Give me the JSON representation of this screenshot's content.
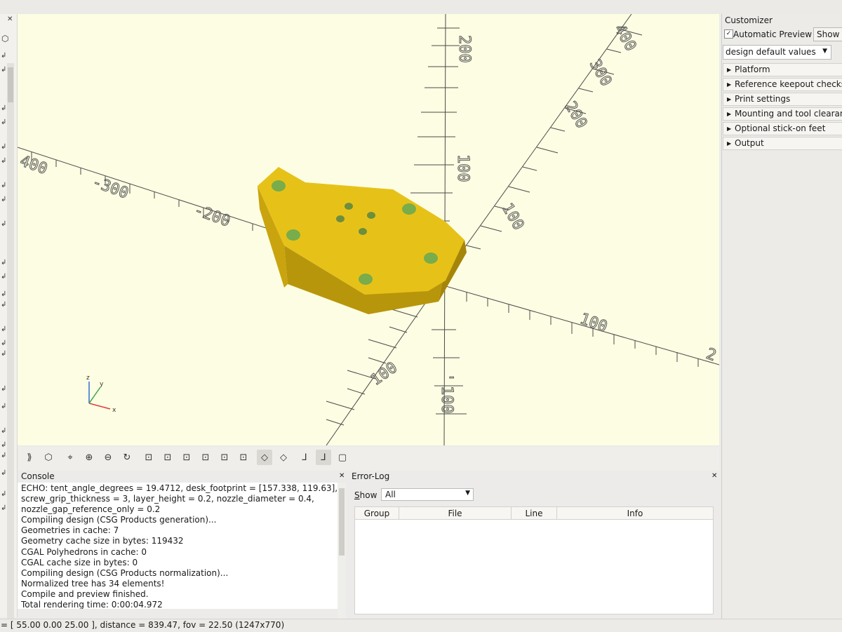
{
  "sidebar": {
    "close": "✕",
    "return_icons": [
      "↲",
      "↲",
      "↲",
      "↲",
      "↲",
      "↲",
      "↲",
      "↲",
      "↲",
      "↲",
      "↲",
      "↲",
      "↲",
      "↲",
      "↲",
      "↲",
      "↲",
      "↲",
      "↲",
      "↲",
      "↲",
      "↲",
      "↲",
      "↲"
    ]
  },
  "viewport": {
    "axis_labels": {
      "neg_x_400": "400",
      "neg_x_300": "-300",
      "neg_x_200": "-200",
      "pos_x_100": "100",
      "pos_x_2": "2",
      "pos_z_200": "200",
      "pos_z_100": "100",
      "neg_z_100": "100",
      "neg_z_sign": "-",
      "diag_400": "400",
      "diag_300": "300",
      "diag_200": "200",
      "diag_100": "100",
      "neg_y_100": "100"
    },
    "gizmo": {
      "z": "z",
      "y": "y",
      "x": "x"
    },
    "colors": {
      "model": "#e6c219",
      "holes": "#79ac4a",
      "background": "#fdfde3"
    }
  },
  "toolbar": {
    "buttons": [
      {
        "name": "render-button",
        "icon": "⟫"
      },
      {
        "name": "preview-button",
        "icon": "⬡"
      },
      {
        "name": "view-all-button",
        "icon": "⌖"
      },
      {
        "name": "zoom-in-button",
        "icon": "⊕"
      },
      {
        "name": "zoom-out-button",
        "icon": "⊖"
      },
      {
        "name": "reset-view-button",
        "icon": "↻"
      },
      {
        "name": "view-right-button",
        "icon": "⊡"
      },
      {
        "name": "view-top-button",
        "icon": "⊡"
      },
      {
        "name": "view-bottom-button",
        "icon": "⊡"
      },
      {
        "name": "view-left-button",
        "icon": "⊡"
      },
      {
        "name": "view-front-button",
        "icon": "⊡"
      },
      {
        "name": "view-back-button",
        "icon": "⊡"
      },
      {
        "name": "perspective-button",
        "icon": "◇"
      },
      {
        "name": "orthogonal-button",
        "icon": "◇"
      },
      {
        "name": "show-axes-button",
        "icon": "⅃"
      },
      {
        "name": "show-scale-button",
        "icon": "⅃"
      },
      {
        "name": "show-edges-button",
        "icon": "▢"
      }
    ]
  },
  "console": {
    "title": "Console",
    "close": "✕",
    "lines": [
      "ECHO: tent_angle_degrees = 19.4712, desk_footprint = [157.338, 119.63],",
      "screw_grip_thickness = 3, layer_height = 0.2, nozzle_diameter = 0.4,",
      "nozzle_gap_reference_only = 0.2",
      "Compiling design (CSG Products generation)...",
      "Geometries in cache: 7",
      "Geometry cache size in bytes: 119432",
      "CGAL Polyhedrons in cache: 0",
      "CGAL cache size in bytes: 0",
      "Compiling design (CSG Products normalization)...",
      "Normalized tree has 34 elements!",
      "Compile and preview finished.",
      "Total rendering time: 0:00:04.972"
    ]
  },
  "errorlog": {
    "title": "Error-Log",
    "close": "✕",
    "show_label_first": "S",
    "show_label_rest": "how",
    "show_value": "All",
    "columns": [
      "Group",
      "File",
      "Line",
      "Info"
    ]
  },
  "customizer": {
    "title": "Customizer",
    "checkbox_mark": "✓",
    "automatic_preview": "Automatic Preview",
    "show_button": "Show D",
    "preset": "design default values",
    "sections": [
      "Platform",
      "Reference keepout checks",
      "Print settings",
      "Mounting and tool clearance",
      "Optional stick-on feet",
      "Output"
    ]
  },
  "status": {
    "text": "= [ 55.00 0.00 25.00 ], distance = 839.47, fov = 22.50 (1247x770)"
  }
}
